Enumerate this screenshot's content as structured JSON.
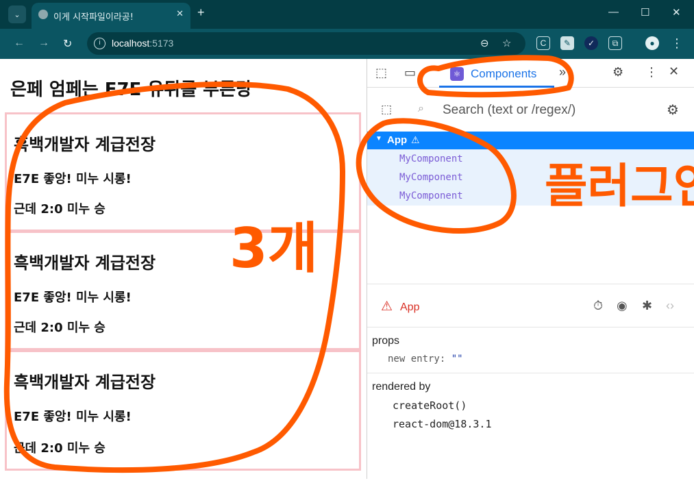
{
  "browser": {
    "tab_title": "이게 시작파일이라공!",
    "tab_close": "✕",
    "new_tab": "+",
    "tab_menu": "⌄",
    "minimize": "—",
    "maximize": "☐",
    "close": "✕",
    "back": "←",
    "forward": "→",
    "reload": "↻",
    "url_host": "localhost",
    "url_port": ":5173",
    "zoom_icon": "⊖",
    "star_icon": "☆",
    "menu_icon": "⋮"
  },
  "page": {
    "title": "은페 엄페는 E7E 유튀를 부른당",
    "cards": [
      {
        "title": "흑백개발자 계급전장",
        "line1": "E7E 좋앙! 미누 시롱!",
        "line2": "근데 2:0 미누 승"
      },
      {
        "title": "흑백개발자 계급전장",
        "line1": "E7E 좋앙! 미누 시롱!",
        "line2": "근데 2:0 미누 승"
      },
      {
        "title": "흑백개발자 계급전장",
        "line1": "E7E 좋앙! 미누 시롱!",
        "line2": "근데 2:0 미누 승"
      }
    ]
  },
  "devtools": {
    "tab_label": "Components",
    "more_tabs": "»",
    "search_placeholder": "Search (text or /regex/)",
    "tree": {
      "root": "App",
      "children": [
        "MyComponent",
        "MyComponent",
        "MyComponent"
      ]
    },
    "selected": {
      "name": "App",
      "props_title": "props",
      "prop_key": "new entry",
      "prop_value": "\"\"",
      "rendered_by_title": "rendered by",
      "rendered_by": [
        "createRoot()",
        "react-dom@18.3.1"
      ]
    }
  },
  "annotations": {
    "count_label": "3개",
    "plugin_label": "플러그인",
    "color": "#ff5a00"
  }
}
